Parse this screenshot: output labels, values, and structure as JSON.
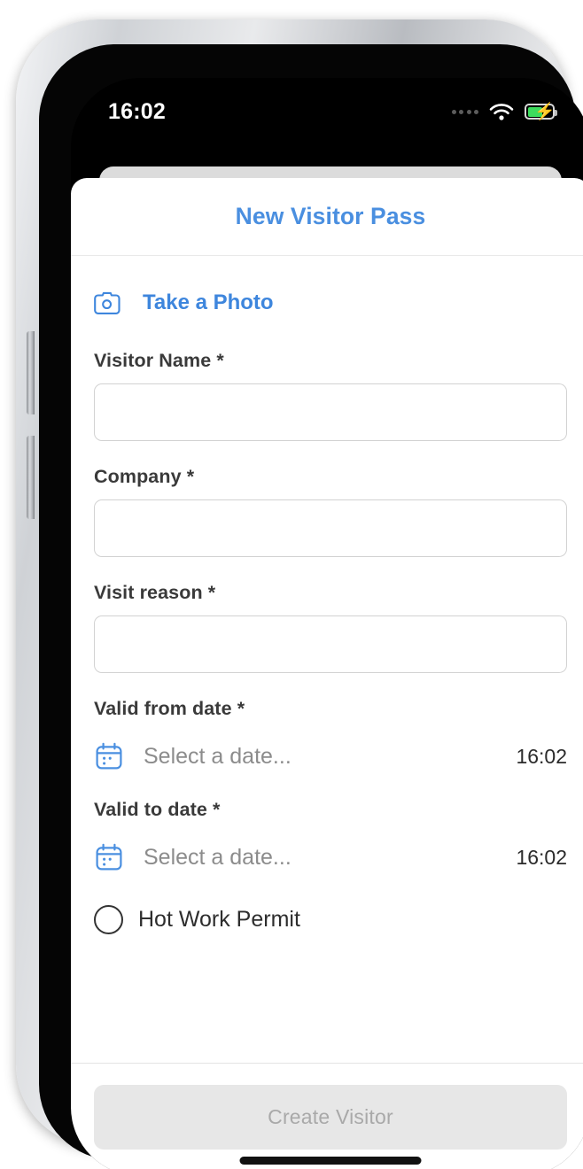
{
  "status_bar": {
    "time": "16:02",
    "signal_icon": "signal-dots-icon",
    "wifi_icon": "wifi-icon",
    "battery_icon": "battery-charging-icon",
    "battery_level_percent": 62,
    "battery_color": "#3ddc5d"
  },
  "sheet": {
    "title": "New Visitor Pass",
    "title_color": "#4a8fe0"
  },
  "photo": {
    "icon": "camera-icon",
    "label": "Take a Photo",
    "color": "#3e86dd"
  },
  "form": {
    "fields": [
      {
        "label": "Visitor Name *",
        "value": "",
        "placeholder": ""
      },
      {
        "label": "Company *",
        "value": "",
        "placeholder": ""
      },
      {
        "label": "Visit reason *",
        "value": "",
        "placeholder": ""
      }
    ],
    "date_fields": [
      {
        "label": "Valid from date *",
        "icon": "calendar-icon",
        "placeholder": "Select a date...",
        "time": "16:02"
      },
      {
        "label": "Valid to date *",
        "icon": "calendar-icon",
        "placeholder": "Select a date...",
        "time": "16:02"
      }
    ],
    "toggle": {
      "label": "Hot Work Permit",
      "icon": "radio-unchecked-icon",
      "checked": false
    }
  },
  "footer": {
    "submit_label": "Create Visitor",
    "submit_enabled": false,
    "submit_bg": "#e7e7e7",
    "submit_text_color": "#a9a9a9"
  }
}
